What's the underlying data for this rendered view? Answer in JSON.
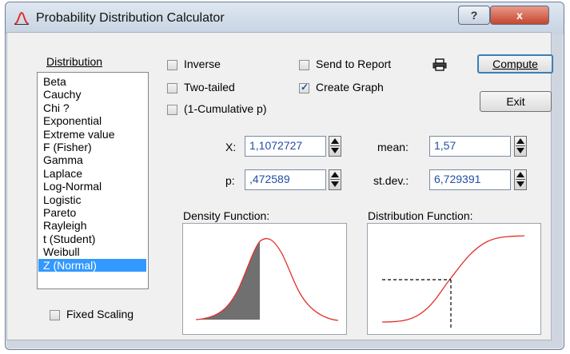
{
  "window": {
    "title": "Probability Distribution Calculator",
    "help_label": "?",
    "close_label": "x"
  },
  "distribution": {
    "label": "Distribution",
    "items": [
      "Beta",
      "Cauchy",
      "Chi ?",
      "Exponential",
      "Extreme value",
      "F (Fisher)",
      "Gamma",
      "Laplace",
      "Log-Normal",
      "Logistic",
      "Pareto",
      "Rayleigh",
      "t (Student)",
      "Weibull",
      "Z (Normal)"
    ],
    "selected": "Z (Normal)"
  },
  "options": {
    "inverse": {
      "label": "Inverse",
      "checked": false
    },
    "two_tailed": {
      "label": "Two-tailed",
      "checked": false
    },
    "one_minus_cumulative": {
      "label": "(1-Cumulative p)",
      "checked": false
    },
    "send_to_report": {
      "label": "Send to Report",
      "checked": false
    },
    "create_graph": {
      "label": "Create Graph",
      "checked": true
    },
    "fixed_scaling": {
      "label": "Fixed Scaling",
      "checked": false
    }
  },
  "buttons": {
    "compute": "Compute",
    "exit": "Exit"
  },
  "fields": {
    "x_label": "X:",
    "x_value": "1,1072727",
    "p_label": "p:",
    "p_value": ",472589",
    "mean_label": "mean:",
    "mean_value": "1,57",
    "stdev_label": "st.dev.:",
    "stdev_value": "6,729391"
  },
  "graphs": {
    "density_label": "Density Function:",
    "distribution_label": "Distribution Function:"
  },
  "colors": {
    "curve": "#e0302a",
    "shaded_area": "#707070",
    "selection": "#3399ff",
    "field_text": "#1f4ea8"
  }
}
